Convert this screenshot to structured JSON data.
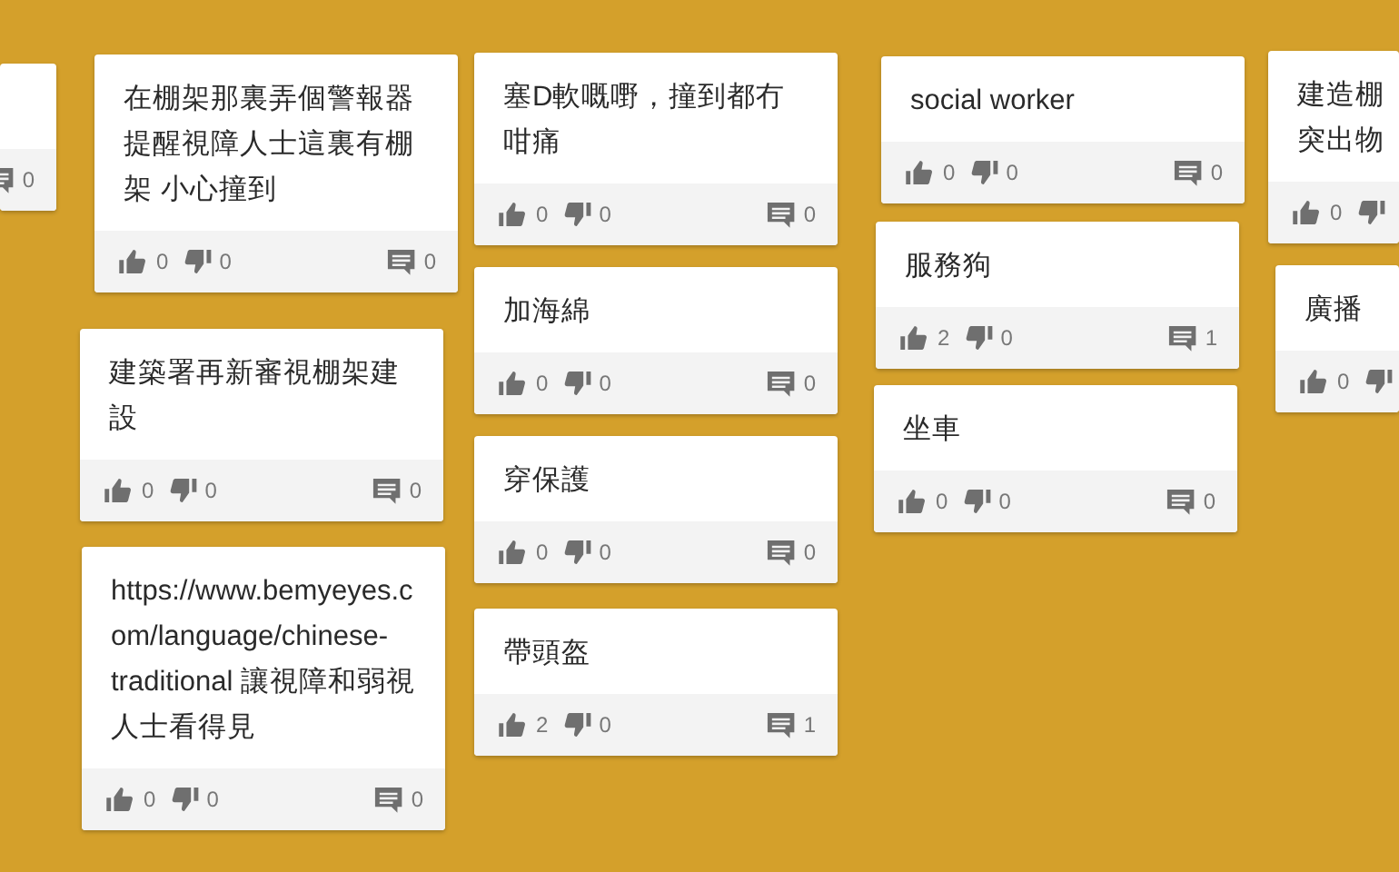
{
  "columns": [
    {
      "cards": [
        {
          "comments": "0"
        }
      ]
    },
    {
      "cards": [
        {
          "text": "在棚架那裏弄個警報器提醒視障人士這裏有棚架 小心撞到",
          "likes": "0",
          "dislikes": "0",
          "comments": "0"
        },
        {
          "text": "建築署再新審視棚架建設",
          "likes": "0",
          "dislikes": "0",
          "comments": "0"
        },
        {
          "text": "https://www.bemyeyes.com/language/chinese-traditional 讓視障和弱視人士看得見",
          "likes": "0",
          "dislikes": "0",
          "comments": "0"
        }
      ]
    },
    {
      "cards": [
        {
          "text": "塞D軟嘅嘢，撞到都冇咁痛",
          "likes": "0",
          "dislikes": "0",
          "comments": "0"
        },
        {
          "text": "加海綿",
          "likes": "0",
          "dislikes": "0",
          "comments": "0"
        },
        {
          "text": "穿保護",
          "likes": "0",
          "dislikes": "0",
          "comments": "0"
        },
        {
          "text": "帶頭盔",
          "likes": "2",
          "dislikes": "0",
          "comments": "1"
        }
      ]
    },
    {
      "cards": [
        {
          "text": "social worker",
          "likes": "0",
          "dislikes": "0",
          "comments": "0"
        },
        {
          "text": "服務狗",
          "likes": "2",
          "dislikes": "0",
          "comments": "1"
        },
        {
          "text": "坐車",
          "likes": "0",
          "dislikes": "0",
          "comments": "0"
        }
      ]
    },
    {
      "cards": [
        {
          "lines": [
            "建造棚",
            "突出物"
          ],
          "likes": "0"
        },
        {
          "text": "廣播",
          "likes": "0"
        }
      ]
    }
  ]
}
